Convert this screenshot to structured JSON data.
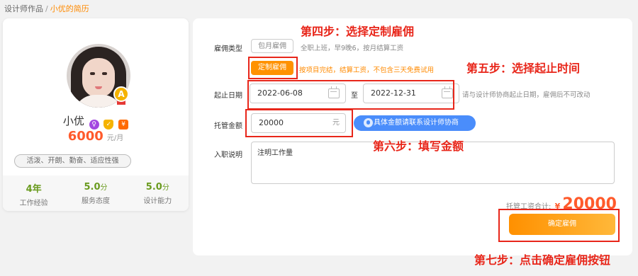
{
  "breadcrumb": {
    "parent": "设计师作品",
    "separator": "/",
    "current": "小优的简历"
  },
  "profile": {
    "name": "小优",
    "level_badge": "A",
    "price": "6000",
    "price_unit": "元/月",
    "tags": "活泼、开朗、勤奋、适应性强",
    "stats": [
      {
        "value": "4年",
        "suffix": "",
        "label": "工作经验"
      },
      {
        "value": "5.0",
        "suffix": "分",
        "label": "服务态度"
      },
      {
        "value": "5.0",
        "suffix": "分",
        "label": "设计能力"
      }
    ],
    "badge_gender": "♀",
    "badge_shield": "✓",
    "badge_yuan": "¥"
  },
  "form": {
    "hire_type_label": "雇佣类型",
    "monthly_option": "包月雇佣",
    "monthly_note": "全职上班，早9晚6，按月结算工资",
    "custom_option": "定制雇佣",
    "custom_note": "按项目完结，结算工资，不包含三天免费试用",
    "date_label": "起止日期",
    "start_date": "2022-06-08",
    "date_sep": "至",
    "end_date": "2022-12-31",
    "date_note": "请与设计师协商起止日期，雇佣后不可改动",
    "amount_label": "托管金额",
    "amount_value": "20000",
    "amount_unit": "元",
    "consult_button": "具体金额请联系设计师协商",
    "desc_label": "入职说明",
    "desc_value": "注明工作量",
    "total_label": "托管工资合计:",
    "total_currency": "¥",
    "total_value": "20000",
    "confirm_button": "确定雇佣"
  },
  "annotations": {
    "step4": "第四步：选择定制雇佣",
    "step5": "第五步：选择起止时间",
    "step6": "第六步：填写金额",
    "step7": "第七步：点击确定雇佣按钮"
  },
  "colors": {
    "accent": "#ff9200",
    "annotation": "#e8261a",
    "price": "#ff5a2b",
    "consult": "#4a8dfb"
  }
}
